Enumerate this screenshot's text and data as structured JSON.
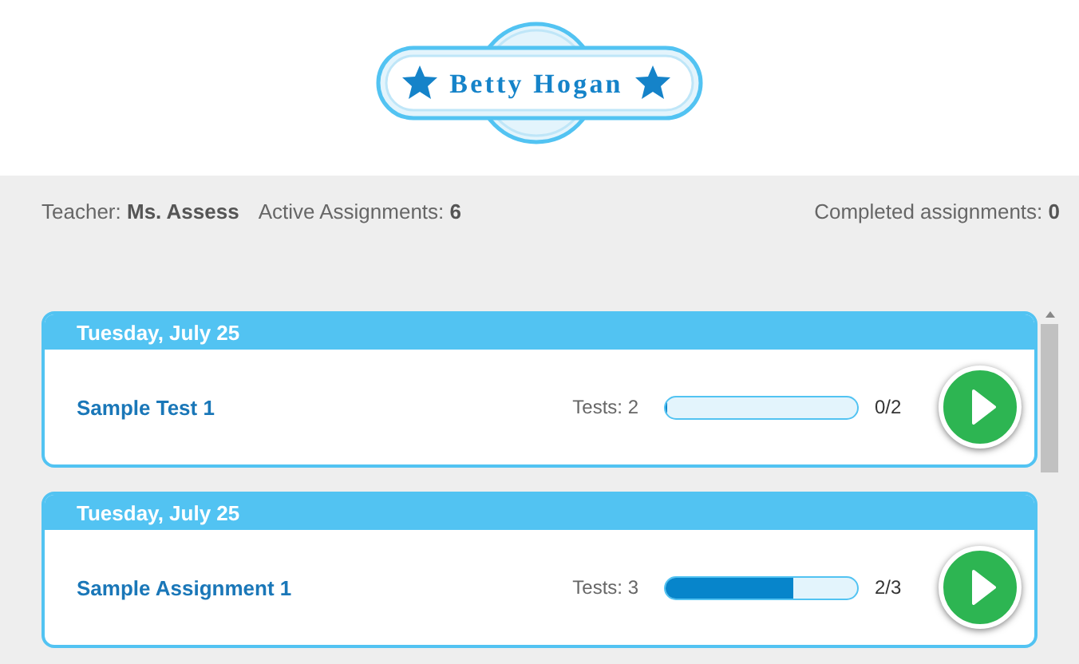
{
  "logo": {
    "name": "Betty Hogan"
  },
  "stats": {
    "teacher": "Teacher: **Ms. Assess**",
    "active": "Active Assignments: **6**",
    "completed": "Completed assignments: **0**"
  },
  "assignments": [
    {
      "date": "Tuesday, July 25",
      "title": "Sample Test 1",
      "tests": "Tests: 2",
      "level": 0,
      "count": "0/2"
    },
    {
      "date": "Tuesday, July 25",
      "title": "Sample Assignment 1",
      "tests": "Tests: 3",
      "level": 0.667,
      "count": "2/3"
    }
  ]
}
